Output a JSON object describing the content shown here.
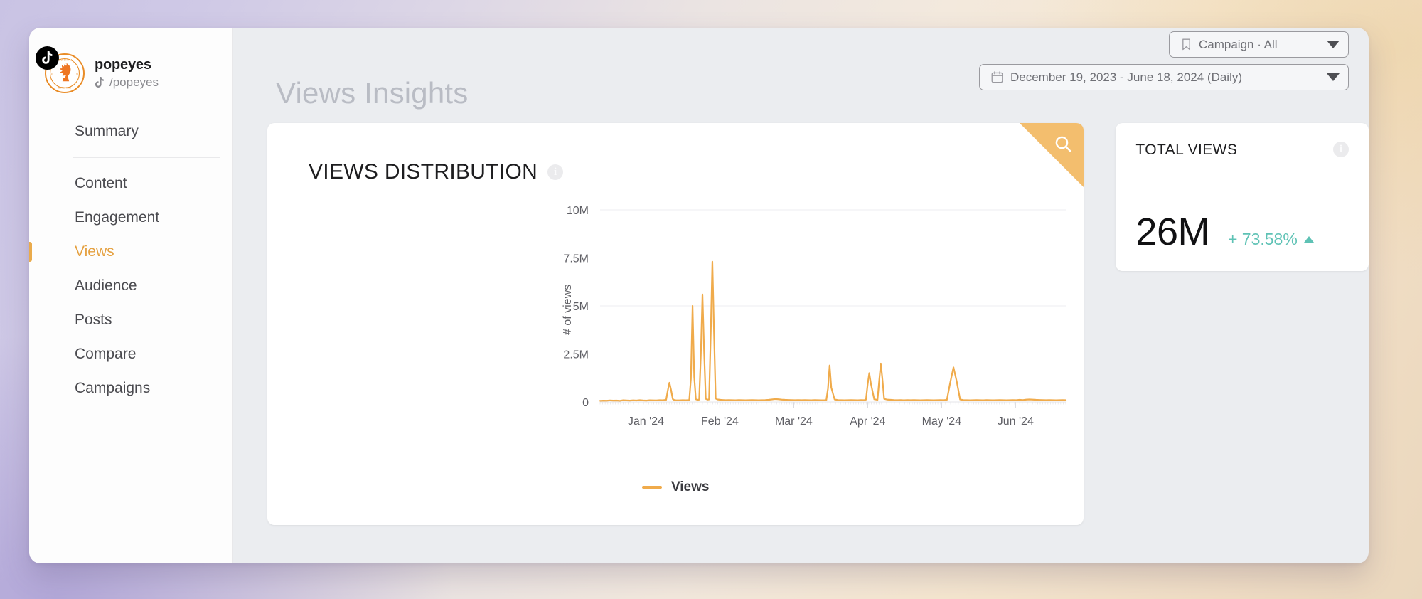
{
  "window": {
    "background_gradient_from": "#c9c3e4",
    "background_gradient_to": "#ead7bd"
  },
  "sidebar": {
    "profile": {
      "name": "popeyes",
      "handle": "/popeyes",
      "platform_icon": "tiktok-icon",
      "avatar_brand_top": "LOUISIANA",
      "avatar_brand_bottom": "KITCHEN"
    },
    "items": [
      {
        "label": "Summary",
        "active": false
      },
      {
        "label": "Content",
        "active": false
      },
      {
        "label": "Engagement",
        "active": false
      },
      {
        "label": "Views",
        "active": true
      },
      {
        "label": "Audience",
        "active": false
      },
      {
        "label": "Posts",
        "active": false
      },
      {
        "label": "Compare",
        "active": false
      },
      {
        "label": "Campaigns",
        "active": false
      }
    ]
  },
  "header": {
    "title": "Views Insights",
    "campaign_filter": {
      "icon": "bookmark-icon",
      "label": "Campaign · All",
      "caret": "chevron-down-icon"
    },
    "date_range": {
      "icon": "calendar-icon",
      "label": "December 19, 2023 - June 18, 2024 (Daily)",
      "caret": "chevron-down-icon"
    }
  },
  "chart_card": {
    "title": "VIEWS DISTRIBUTION",
    "info_icon": "info-icon",
    "corner_action_icon": "search-icon",
    "accent_color": "#f3be6e"
  },
  "stat_card": {
    "label": "TOTAL VIEWS",
    "info_icon": "info-icon",
    "value": "26M",
    "delta": "+ 73.58%",
    "delta_direction": "up",
    "delta_color": "#5ec2b5"
  },
  "chart_data": {
    "type": "line",
    "title": "VIEWS DISTRIBUTION",
    "xlabel": "",
    "ylabel": "# of views",
    "line_color": "#f0ab4b",
    "grid": true,
    "legend": [
      {
        "name": "Views",
        "color": "#f0ab4b"
      }
    ],
    "legend_position": "bottom-center",
    "ylim": [
      0,
      10000000
    ],
    "ytick_labels": [
      "0",
      "2.5M",
      "5M",
      "7.5M",
      "10M"
    ],
    "ytick_values": [
      0,
      2500000,
      5000000,
      7500000,
      10000000
    ],
    "xtick_labels": [
      "Jan '24",
      "Feb '24",
      "Mar '24",
      "Apr '24",
      "May '24",
      "Jun '24"
    ],
    "x_start": "2023-12-19",
    "x_end": "2024-06-18",
    "series": [
      {
        "name": "Views",
        "x": [
          0,
          2,
          4,
          6,
          8,
          10,
          12,
          14,
          16,
          18,
          20,
          22,
          24,
          26,
          28,
          30,
          32,
          34,
          36,
          38,
          40,
          41,
          42,
          43,
          44,
          45,
          46,
          48,
          50,
          52,
          54,
          55,
          56,
          57,
          58,
          59,
          60,
          61,
          62,
          63,
          64,
          65,
          66,
          67,
          68,
          69,
          70,
          71,
          72,
          73,
          74,
          75,
          76,
          78,
          80,
          82,
          84,
          86,
          88,
          90,
          92,
          94,
          96,
          98,
          100,
          102,
          104,
          106,
          108,
          110,
          112,
          114,
          116,
          118,
          120,
          122,
          124,
          126,
          128,
          130,
          132,
          134,
          136,
          137,
          138,
          139,
          140,
          142,
          144,
          146,
          148,
          150,
          152,
          154,
          156,
          158,
          160,
          161,
          162,
          163,
          164,
          166,
          168,
          169,
          170,
          171,
          172,
          174,
          176,
          178,
          180,
          182,
          183,
          184,
          185,
          186,
          188,
          190,
          192,
          194,
          196,
          198,
          200,
          202,
          204,
          206,
          208,
          210,
          212,
          214,
          216,
          218,
          220,
          222,
          224,
          226,
          228,
          230,
          232,
          234,
          236,
          238,
          240,
          242,
          244,
          246,
          248,
          250,
          252,
          254,
          256,
          258,
          260,
          262,
          264,
          266,
          268,
          270,
          272,
          274,
          276,
          278,
          280,
          282
        ],
        "y": [
          60000,
          70000,
          65000,
          80000,
          70000,
          75000,
          60000,
          90000,
          80000,
          70000,
          85000,
          75000,
          95000,
          80000,
          70000,
          90000,
          85000,
          80000,
          95000,
          90000,
          110000,
          600000,
          1000000,
          620000,
          150000,
          95000,
          90000,
          85000,
          95000,
          90000,
          100000,
          1200000,
          5000000,
          1300000,
          140000,
          110000,
          120000,
          2400000,
          5600000,
          2600000,
          160000,
          120000,
          130000,
          3500000,
          7300000,
          3600000,
          180000,
          130000,
          120000,
          110000,
          105000,
          100000,
          95000,
          100000,
          95000,
          90000,
          100000,
          95000,
          90000,
          95000,
          100000,
          95000,
          90000,
          95000,
          100000,
          110000,
          130000,
          150000,
          140000,
          120000,
          110000,
          105000,
          100000,
          95000,
          100000,
          95000,
          100000,
          95000,
          90000,
          100000,
          95000,
          90000,
          95000,
          100000,
          700000,
          1900000,
          750000,
          130000,
          100000,
          95000,
          90000,
          95000,
          100000,
          95000,
          90000,
          100000,
          95000,
          120000,
          900000,
          1500000,
          950000,
          140000,
          110000,
          1100000,
          2000000,
          1150000,
          160000,
          120000,
          110000,
          100000,
          95000,
          100000,
          95000,
          90000,
          95000,
          100000,
          95000,
          100000,
          95000,
          90000,
          95000,
          100000,
          95000,
          90000,
          95000,
          100000,
          95000,
          110000,
          1000000,
          1800000,
          1050000,
          130000,
          100000,
          95000,
          90000,
          95000,
          100000,
          95000,
          90000,
          100000,
          95000,
          90000,
          95000,
          100000,
          95000,
          90000,
          95000,
          100000,
          95000,
          110000,
          100000,
          120000,
          130000,
          120000,
          110000,
          105000,
          100000,
          95000,
          100000,
          95000,
          90000,
          95000,
          100000,
          95000,
          90000,
          95000
        ]
      }
    ]
  }
}
